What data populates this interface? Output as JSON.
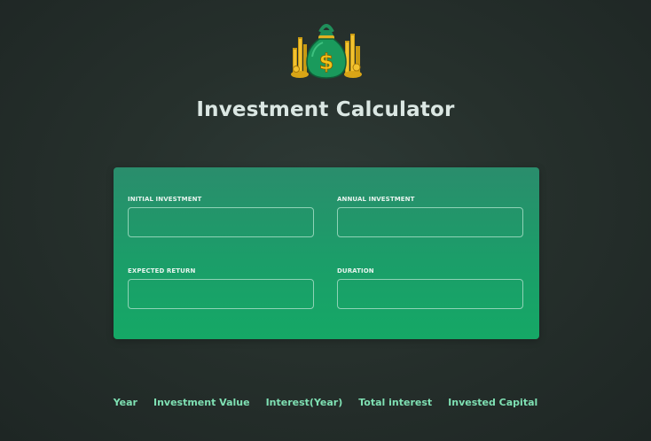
{
  "header": {
    "logo_icon": "money-bag-icon",
    "title": "Investment Calculator"
  },
  "form": {
    "fields": [
      {
        "label": "INITIAL INVESTMENT",
        "value": ""
      },
      {
        "label": "ANNUAL INVESTMENT",
        "value": ""
      },
      {
        "label": "EXPECTED RETURN",
        "value": ""
      },
      {
        "label": "DURATION",
        "value": ""
      }
    ]
  },
  "results_table": {
    "columns": [
      "Year",
      "Investment Value",
      "Interest(Year)",
      "Total interest",
      "Invested Capital"
    ]
  },
  "colors": {
    "background": "#26302c",
    "card_top": "#2a8d6c",
    "card_bottom": "#15a866",
    "header_text": "#7fe0b3",
    "title_text": "#dbe7e3"
  }
}
